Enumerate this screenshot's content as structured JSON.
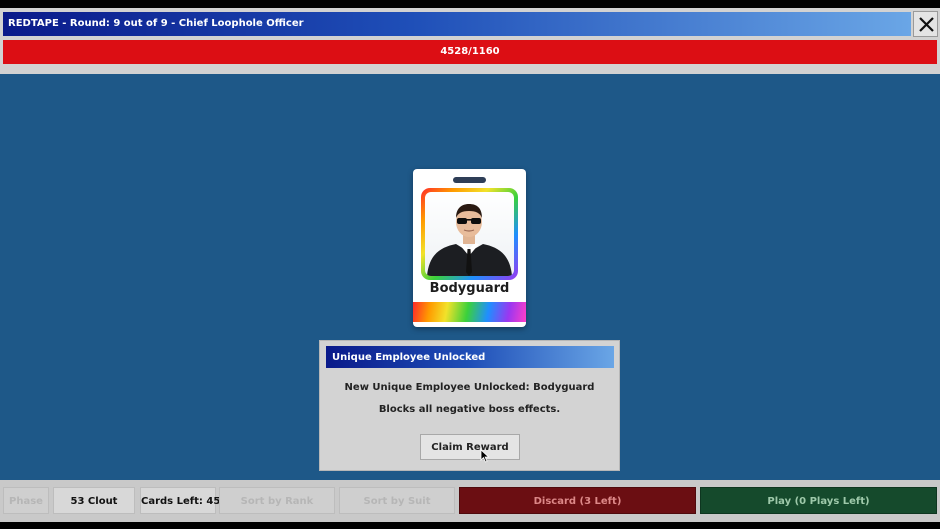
{
  "header": {
    "title": "REDTAPE - Round: 9 out of 9 - Chief Loophole Officer",
    "score_progress": "4528/1160",
    "close_icon": "close-x-icon"
  },
  "employee_card": {
    "name": "Bodyguard",
    "portrait_icon": "bodyguard-portrait"
  },
  "dialog": {
    "title": "Unique Employee Unlocked",
    "message": "New Unique Employee Unlocked: Bodyguard",
    "description": "Blocks all negative boss effects.",
    "claim_label": "Claim Reward"
  },
  "bottom_bar": {
    "first_label": "Phase",
    "clout": "53 Clout",
    "cards_left": "Cards Left: 45",
    "sort_rank_label": "Sort by Rank",
    "sort_suit_label": "Sort by Suit",
    "discard_label": "Discard (3 Left)",
    "play_label": "Play (0 Plays Left)"
  },
  "colors": {
    "background": "#1e5888",
    "progress_bar": "#dc0e14",
    "discard_button": "#6b0e12",
    "play_button": "#154a2c"
  }
}
